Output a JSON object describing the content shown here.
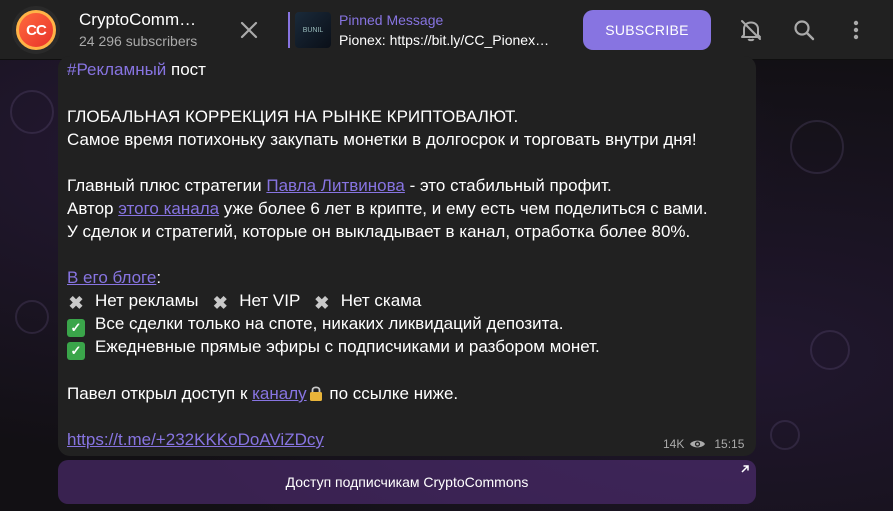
{
  "header": {
    "channel_title": "CryptoCommons",
    "subscribers": "24 296 subscribers",
    "avatar_text": "CC",
    "pinned_label": "Pinned Message",
    "pinned_text": "Pionex: https://bit.ly/CC_Pionex…",
    "pinned_thumb_text": "BUNIL",
    "subscribe_label": "SUBSCRIBE"
  },
  "message": {
    "hashtag": "#Рекламный",
    "hashtag_rest": " пост",
    "l1": "ГЛОБАЛЬНАЯ КОРРЕКЦИЯ НА РЫНКЕ КРИПТОВАЛЮТ.",
    "l2": "Самое время потихоньку закупать монетки в долгосрок и торговать внутри дня!",
    "l3a": "Главный плюс стратегии ",
    "l3link": "Павла Литвинова",
    "l3b": " - это стабильный профит.",
    "l4a": "Автор ",
    "l4link": "этого канала",
    "l4b": " уже более 6 лет в крипте, и ему есть чем поделиться с вами.",
    "l5": "У сделок и стратегий, которые он выкладывает в канал, отработка более 80%.",
    "l6link": "В его блоге",
    "l6b": ":",
    "f1": "Нет рекламы",
    "f2": "Нет VIP",
    "f3": "Нет скама",
    "c1": "Все сделки только на споте, никаких ликвидаций депозита.",
    "c2": "Ежедневные прямые эфиры с подписчиками и разбором монет.",
    "l7a": "Павел открыл доступ к ",
    "l7link": "каналу",
    "l7b": " по ссылке ниже.",
    "url": "https://t.me/+232KKKoDoAViZDcy",
    "views": "14K",
    "time": "15:15"
  },
  "inline_button": {
    "label": "Доступ подписчикам CryptoCommons"
  },
  "colors": {
    "accent": "#8774e1",
    "header_bg": "#212121",
    "bubble_bg": "#212121"
  },
  "icons": [
    "close-icon",
    "mute-bell-icon",
    "search-icon",
    "more-vertical-icon",
    "eye-icon",
    "external-arrow-icon",
    "lock-icon"
  ]
}
